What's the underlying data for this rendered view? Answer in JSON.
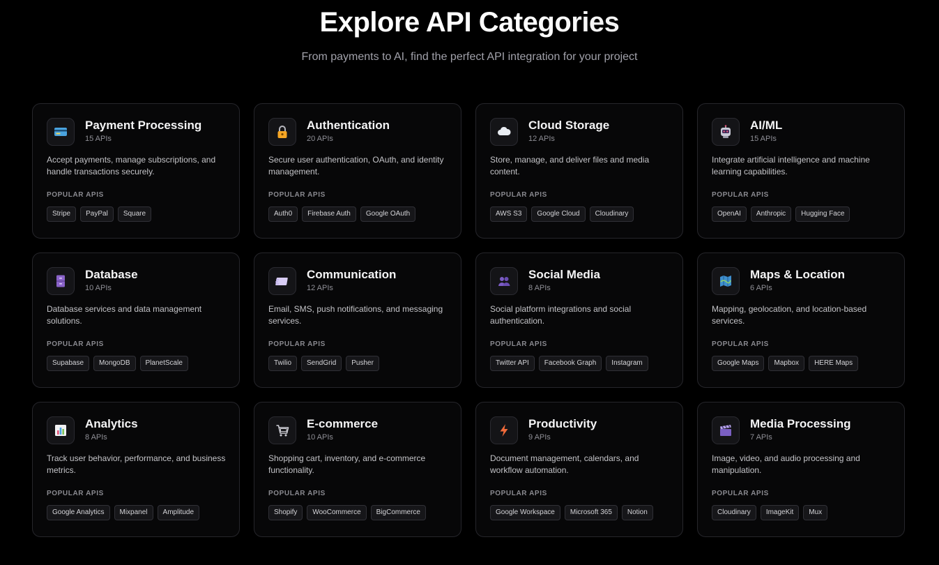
{
  "header": {
    "title": "Explore API Categories",
    "subtitle": "From payments to AI, find the perfect API integration for your project"
  },
  "popular_label": "POPULAR APIS",
  "categories": [
    {
      "title": "Payment Processing",
      "count": "15 APIs",
      "description": "Accept payments, manage subscriptions, and handle transactions securely.",
      "icon": "credit-card-icon",
      "apis": [
        "Stripe",
        "PayPal",
        "Square"
      ]
    },
    {
      "title": "Authentication",
      "count": "20 APIs",
      "description": "Secure user authentication, OAuth, and identity management.",
      "icon": "lock-icon",
      "apis": [
        "Auth0",
        "Firebase Auth",
        "Google OAuth"
      ]
    },
    {
      "title": "Cloud Storage",
      "count": "12 APIs",
      "description": "Store, manage, and deliver files and media content.",
      "icon": "cloud-icon",
      "apis": [
        "AWS S3",
        "Google Cloud",
        "Cloudinary"
      ]
    },
    {
      "title": "AI/ML",
      "count": "15 APIs",
      "description": "Integrate artificial intelligence and machine learning capabilities.",
      "icon": "robot-icon",
      "apis": [
        "OpenAI",
        "Anthropic",
        "Hugging Face"
      ]
    },
    {
      "title": "Database",
      "count": "10 APIs",
      "description": "Database services and data management solutions.",
      "icon": "file-cabinet-icon",
      "apis": [
        "Supabase",
        "MongoDB",
        "PlanetScale"
      ]
    },
    {
      "title": "Communication",
      "count": "12 APIs",
      "description": "Email, SMS, push notifications, and messaging services.",
      "icon": "envelope-icon",
      "apis": [
        "Twilio",
        "SendGrid",
        "Pusher"
      ]
    },
    {
      "title": "Social Media",
      "count": "8 APIs",
      "description": "Social platform integrations and social authentication.",
      "icon": "users-icon",
      "apis": [
        "Twitter API",
        "Facebook Graph",
        "Instagram"
      ]
    },
    {
      "title": "Maps & Location",
      "count": "6 APIs",
      "description": "Mapping, geolocation, and location-based services.",
      "icon": "map-icon",
      "apis": [
        "Google Maps",
        "Mapbox",
        "HERE Maps"
      ]
    },
    {
      "title": "Analytics",
      "count": "8 APIs",
      "description": "Track user behavior, performance, and business metrics.",
      "icon": "bar-chart-icon",
      "apis": [
        "Google Analytics",
        "Mixpanel",
        "Amplitude"
      ]
    },
    {
      "title": "E-commerce",
      "count": "10 APIs",
      "description": "Shopping cart, inventory, and e-commerce functionality.",
      "icon": "shopping-cart-icon",
      "apis": [
        "Shopify",
        "WooCommerce",
        "BigCommerce"
      ]
    },
    {
      "title": "Productivity",
      "count": "9 APIs",
      "description": "Document management, calendars, and workflow automation.",
      "icon": "lightning-icon",
      "apis": [
        "Google Workspace",
        "Microsoft 365",
        "Notion"
      ]
    },
    {
      "title": "Media Processing",
      "count": "7 APIs",
      "description": "Image, video, and audio processing and manipulation.",
      "icon": "clapperboard-icon",
      "apis": [
        "Cloudinary",
        "ImageKit",
        "Mux"
      ]
    }
  ]
}
